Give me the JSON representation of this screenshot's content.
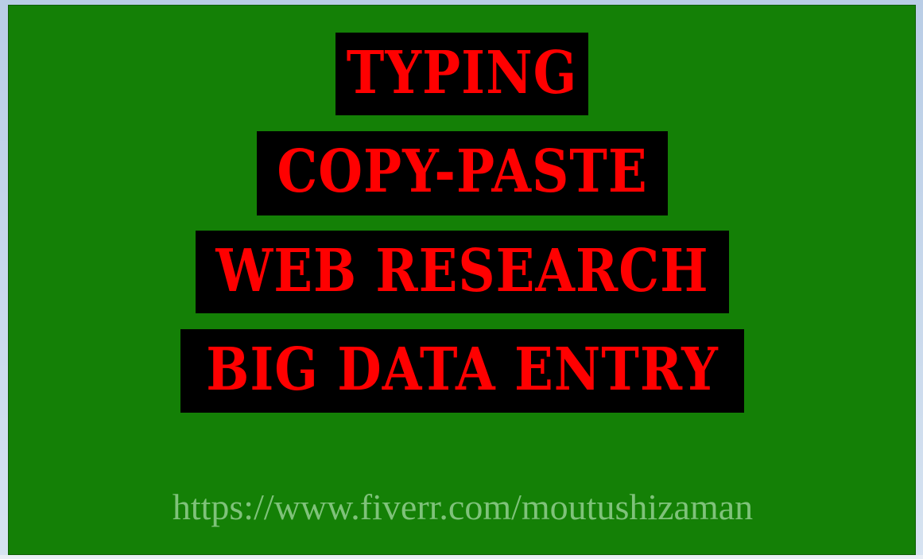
{
  "slide": {
    "lines": [
      "TYPING",
      "COPY-PASTE",
      "WEB RESEARCH",
      "BIG DATA ENTRY"
    ],
    "url": "https://www.fiverr.com/moutushizaman"
  },
  "colors": {
    "background": "#148006",
    "banner_bg": "#000000",
    "banner_text": "#ff0000",
    "url_text": "#7fc27a"
  }
}
